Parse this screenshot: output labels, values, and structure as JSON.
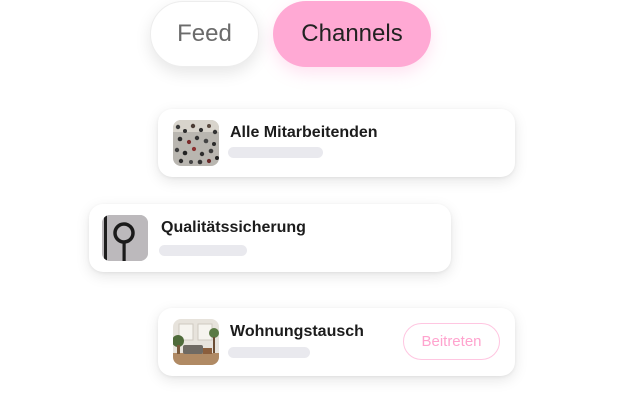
{
  "tabs": {
    "feed": "Feed",
    "channels": "Channels"
  },
  "channels": [
    {
      "name": "Alle Mitarbeitenden",
      "thumb_icon": "crowd-photo"
    },
    {
      "name": "Qualitätssicherung",
      "thumb_icon": "magnifier-photo"
    },
    {
      "name": "Wohnungstausch",
      "thumb_icon": "living-room-photo",
      "join_label": "Beitreten"
    }
  ],
  "colors": {
    "accent": "#ffa9d4",
    "join_text": "#ffa3ce",
    "join_border": "#ffc6e1",
    "placeholder_bar": "#e9e9ee"
  }
}
